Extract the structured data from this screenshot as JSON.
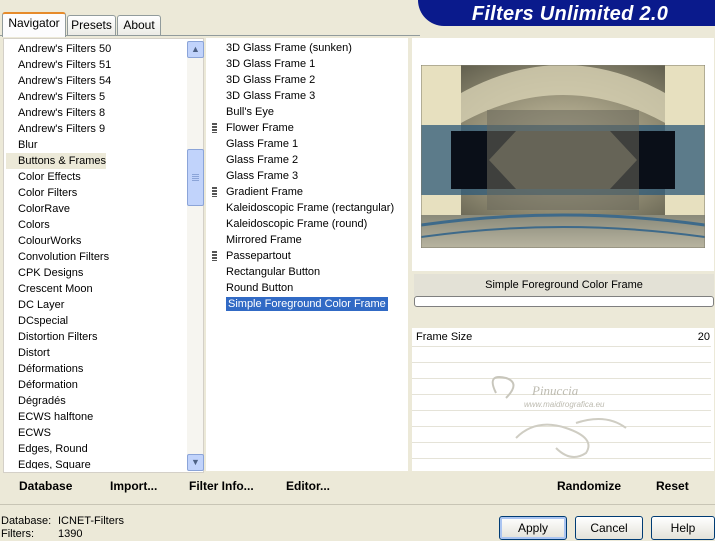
{
  "tabs": [
    {
      "label": "Navigator"
    },
    {
      "label": "Presets"
    },
    {
      "label": "About"
    }
  ],
  "banner_title": "Filters Unlimited 2.0",
  "categories": [
    "Andrew's Filters 50",
    "Andrew's Filters 51",
    "Andrew's Filters 54",
    "Andrew's Filters 5",
    "Andrew's Filters 8",
    "Andrew's Filters 9",
    "Blur",
    "Buttons & Frames",
    "Color Effects",
    "Color Filters",
    "ColorRave",
    "Colors",
    "ColourWorks",
    "Convolution Filters",
    "CPK Designs",
    "Crescent Moon",
    "DC Layer",
    "DCspecial",
    "Distortion Filters",
    "Distort",
    "Déformations",
    "Déformation",
    "Dégradés",
    "ECWS halftone",
    "ECWS",
    "Edges, Round",
    "Edges, Square"
  ],
  "selected_category": "Buttons & Frames",
  "filters": [
    {
      "label": "3D Glass Frame (sunken)",
      "grip": false
    },
    {
      "label": "3D Glass Frame 1",
      "grip": false
    },
    {
      "label": "3D Glass Frame 2",
      "grip": false
    },
    {
      "label": "3D Glass Frame 3",
      "grip": false
    },
    {
      "label": "Bull's Eye",
      "grip": false
    },
    {
      "label": "Flower Frame",
      "grip": true
    },
    {
      "label": "Glass Frame 1",
      "grip": false
    },
    {
      "label": "Glass Frame 2",
      "grip": false
    },
    {
      "label": "Glass Frame 3",
      "grip": false
    },
    {
      "label": "Gradient Frame",
      "grip": true
    },
    {
      "label": "Kaleidoscopic Frame (rectangular)",
      "grip": false
    },
    {
      "label": "Kaleidoscopic Frame (round)",
      "grip": false
    },
    {
      "label": "Mirrored Frame",
      "grip": false
    },
    {
      "label": "Passepartout",
      "grip": true
    },
    {
      "label": "Rectangular Button",
      "grip": false
    },
    {
      "label": "Round Button",
      "grip": false
    },
    {
      "label": "Simple Foreground Color Frame",
      "grip": false
    }
  ],
  "selected_filter": "Simple Foreground Color Frame",
  "preview": {
    "filter_name": "Simple Foreground Color Frame"
  },
  "params": [
    {
      "label": "Frame Size",
      "value": "20"
    }
  ],
  "watermark": {
    "name": "Pinuccia",
    "url": "www.maidirografica.eu"
  },
  "left_buttons": {
    "database": "Database",
    "import": "Import...",
    "filter_info": "Filter Info...",
    "editor": "Editor..."
  },
  "right_buttons": {
    "randomize": "Randomize",
    "reset": "Reset"
  },
  "status": {
    "database_label": "Database:",
    "database_value": "ICNET-Filters",
    "filters_label": "Filters:",
    "filters_value": "1390"
  },
  "dialog_buttons": {
    "apply": "Apply",
    "cancel": "Cancel",
    "help": "Help"
  },
  "colors": {
    "selection": "#316ac5",
    "banner": "#0a1a8c",
    "tab_accent": "#e68b2c"
  }
}
